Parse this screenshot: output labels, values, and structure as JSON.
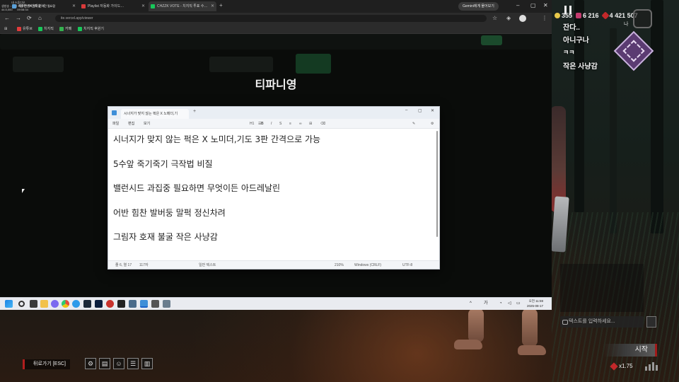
{
  "browser": {
    "tabs": [
      {
        "label": "제3탄 두번째 분석",
        "favicon_color": "#5aa0d8"
      },
      {
        "label": "Playlist 자동화 가이드…",
        "favicon_color": "#d83a3a"
      },
      {
        "label": "CHZZK VOTE - 치지직 투표 수…",
        "favicon_color": "#18c75a"
      }
    ],
    "gemini_label": "Gemini에게 물어보기",
    "url": "ite.vercel.app/viewer",
    "bookmarks": [
      {
        "label": "유튜브",
        "color": "#e23b3b"
      },
      {
        "label": "치지직",
        "color": "#18c75a"
      },
      {
        "label": "카페",
        "color": "#35b14f"
      },
      {
        "label": "치지직 후원기",
        "color": "#18c75a"
      }
    ]
  },
  "viewer": {
    "title": "티파니영"
  },
  "overlay_top_left": {
    "line1": "내 스튜디오",
    "line2": "생방송 ↓",
    "line3": "내가 다른 컨텐츠 생각할 시간 필요함",
    "line4": "44.5,000",
    "line5": "09:08:34"
  },
  "notepad": {
    "tab_title": "시너지가 맞지 않는 퍽은 X 노메더,기",
    "menu": [
      "파일",
      "편집",
      "보기"
    ],
    "tool_heading": "H1",
    "lines": [
      "시너지가 맞지 않는 퍽은 X 노미더,기도 3판 간격으로 가능",
      "5수앞 죽기죽기 극작법 비질",
      "밸런시드 과집중 필요하면 무엇이든 아드레날린",
      "어반 힘찬 발버둥 말퍽 정신차려",
      "그림자 호재 불굴 작은 사냥감"
    ],
    "status": {
      "position": "줄 6, 열 17",
      "chars": "117자",
      "format": "일반 텍스트",
      "zoom": "210%",
      "eol": "Windows (CRLF)",
      "encoding": "UTF-8"
    }
  },
  "taskbar": {
    "ime": "가",
    "time": "오전 11:59",
    "date": "2025-08-17"
  },
  "game": {
    "currencies": [
      {
        "value": "355",
        "color": "#e7c84a"
      },
      {
        "value": "6 216",
        "color": "#c23b6e"
      },
      {
        "value": "4 421 507",
        "color": "#c3282a"
      }
    ],
    "level_label": "나",
    "chat_messages": [
      "잔다..",
      "아니구나",
      "ㅋㅋ",
      "작은 사냥감"
    ],
    "chat_placeholder": "텍스트를 입력하세요...",
    "start_label": "시작",
    "bp_multiplier": "x1.75",
    "back_label": "뒤로가기 [ESC]"
  }
}
